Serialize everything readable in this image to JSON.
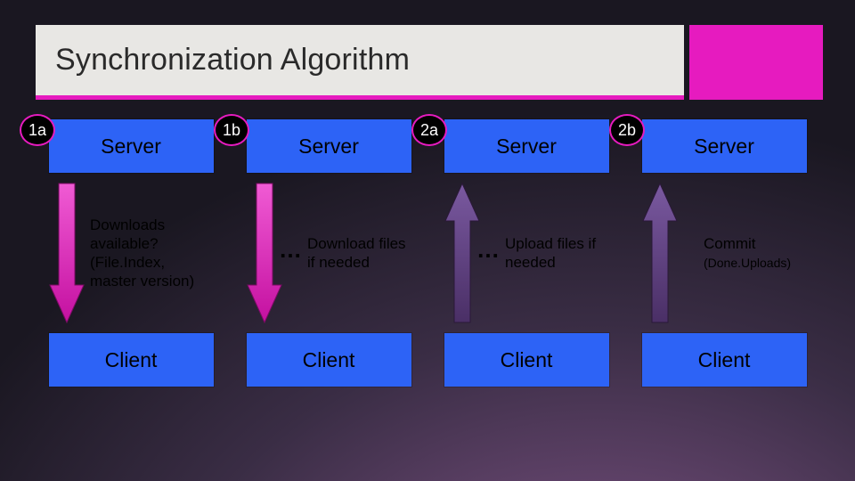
{
  "title": "Synchronization Algorithm",
  "columns": [
    {
      "badge": "1a",
      "top": "Server",
      "bottom": "Client",
      "dots": "",
      "msg": "Downloads available? (File.Index, master version)",
      "sub": "",
      "arrow": {
        "dir": "down",
        "fill": "#e61bbf"
      }
    },
    {
      "badge": "1b",
      "top": "Server",
      "bottom": "Client",
      "dots": "…",
      "msg": "Download files if needed",
      "sub": "",
      "arrow": {
        "dir": "down",
        "fill": "#e61bbf"
      }
    },
    {
      "badge": "2a",
      "top": "Server",
      "bottom": "Client",
      "dots": "…",
      "msg": "Upload files if needed",
      "sub": "",
      "arrow": {
        "dir": "up",
        "fill": "#5a3a7a"
      }
    },
    {
      "badge": "2b",
      "top": "Server",
      "bottom": "Client",
      "dots": "",
      "msg": "Commit",
      "sub": "(Done.Uploads)",
      "arrow": {
        "dir": "up",
        "fill": "#5a3a7a"
      }
    }
  ]
}
